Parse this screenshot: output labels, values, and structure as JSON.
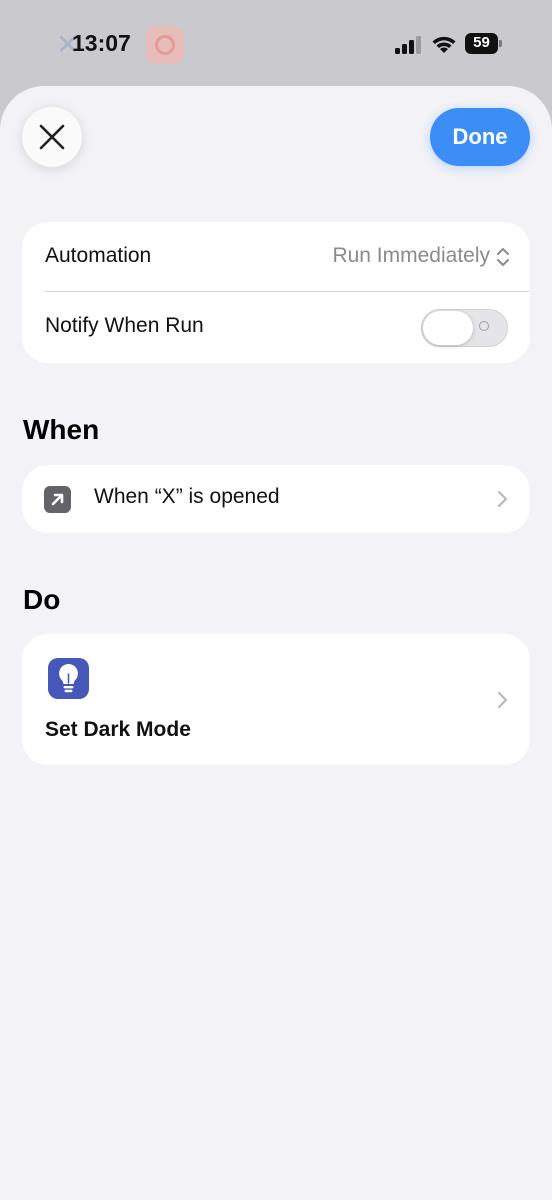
{
  "status_bar": {
    "time": "13:07",
    "battery": "59",
    "icons": [
      "signal-icon",
      "wifi-icon",
      "battery-icon"
    ]
  },
  "header": {
    "close_icon": "close-icon",
    "done_label": "Done"
  },
  "settings": {
    "automation_label": "Automation",
    "automation_value": "Run Immediately",
    "notify_label": "Notify When Run",
    "notify_on": false
  },
  "when": {
    "title": "When",
    "trigger_label": "When “X” is opened",
    "icon": "arrow-up-right-icon"
  },
  "do": {
    "title": "Do",
    "action_label": "Set Dark Mode",
    "icon": "lightbulb-icon"
  },
  "colors": {
    "accent": "#3a8ef6",
    "sheet_bg": "#f2f2f7",
    "action_icon_bg": "#4557b8",
    "trigger_icon_bg": "#646468"
  }
}
